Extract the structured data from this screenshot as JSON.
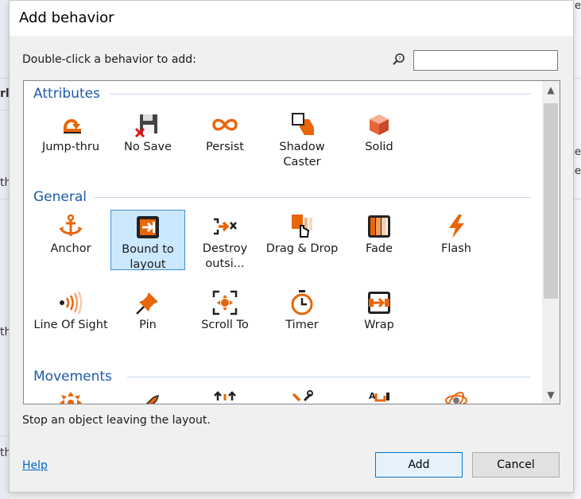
{
  "dialog": {
    "title": "Add behavior",
    "instruction": "Double-click a behavior to add:",
    "search": {
      "value": "",
      "placeholder": ""
    },
    "status": "Stop an object leaving the layout.",
    "help_label": "Help",
    "add_label": "Add",
    "cancel_label": "Cancel"
  },
  "groups": [
    {
      "name": "Attributes",
      "items": [
        {
          "label": "Jump-thru",
          "icon": "jump-thru-icon"
        },
        {
          "label": "No Save",
          "icon": "no-save-icon"
        },
        {
          "label": "Persist",
          "icon": "infinity-icon"
        },
        {
          "label": "Shadow Caster",
          "icon": "shadow-caster-icon"
        },
        {
          "label": "Solid",
          "icon": "solid-cube-icon"
        }
      ]
    },
    {
      "name": "General",
      "items": [
        {
          "label": "Anchor",
          "icon": "anchor-icon"
        },
        {
          "label": "Bound to layout",
          "icon": "bound-to-layout-icon",
          "selected": true
        },
        {
          "label": "Destroy outsi...",
          "icon": "destroy-outside-icon"
        },
        {
          "label": "Drag & Drop",
          "icon": "drag-drop-icon"
        },
        {
          "label": "Fade",
          "icon": "fade-icon"
        },
        {
          "label": "Flash",
          "icon": "flash-icon"
        },
        {
          "label": "Line Of Sight",
          "icon": "line-of-sight-icon"
        },
        {
          "label": "Pin",
          "icon": "pin-icon"
        },
        {
          "label": "Scroll To",
          "icon": "scroll-to-icon"
        },
        {
          "label": "Timer",
          "icon": "timer-icon"
        },
        {
          "label": "Wrap",
          "icon": "wrap-icon"
        }
      ]
    },
    {
      "name": "Movements",
      "items": [
        {
          "label": "",
          "icon": "eight-direction-icon"
        },
        {
          "label": "",
          "icon": "bullet-icon"
        },
        {
          "label": "",
          "icon": "car-icon"
        },
        {
          "label": "",
          "icon": "custom-movement-icon"
        },
        {
          "label": "",
          "icon": "pathfinding-icon"
        },
        {
          "label": "",
          "icon": "physics-icon"
        }
      ]
    }
  ],
  "colors": {
    "accent": "#1e5aa8",
    "icon_orange": "#e8650a",
    "selection": "#cce8ff"
  }
}
